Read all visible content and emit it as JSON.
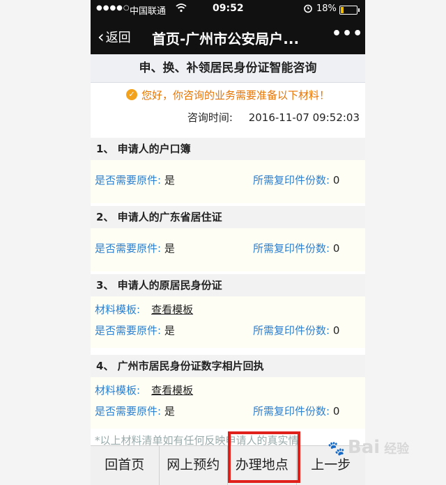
{
  "status_bar": {
    "signal": "●●●●○",
    "carrier": "中国联通",
    "time": "09:52",
    "battery_text": "18%",
    "battery_level": 0.18
  },
  "nav": {
    "back_label": "返回",
    "title": "首页-广州市公安局户...",
    "more": "•••"
  },
  "page_header": "申、换、补领居民身份证智能咨询",
  "notice": "您好，你咨询的业务需要准备以下材料！",
  "query_time": {
    "label": "咨询时间:",
    "value": "2016-11-07 09:52:03"
  },
  "sections": [
    {
      "title": "1、 申请人的户口簿",
      "original_label": "是否需要原件:",
      "original_value": "是",
      "copies_label": "所需复印件份数:",
      "copies_value": "0"
    },
    {
      "title": "2、 申请人的广东省居住证",
      "original_label": "是否需要原件:",
      "original_value": "是",
      "copies_label": "所需复印件份数:",
      "copies_value": "0"
    },
    {
      "title": "3、 申请人的原居民身份证",
      "template_label": "材料模板:",
      "template_link": "查看模板",
      "original_label": "是否需要原件:",
      "original_value": "是",
      "copies_label": "所需复印件份数:",
      "copies_value": "0"
    },
    {
      "title": "4、 广州市居民身份证数字相片回执",
      "template_label": "材料模板:",
      "template_link": "查看模板",
      "original_label": "是否需要原件:",
      "original_value": "是",
      "copies_label": "所需复印件份数:",
      "copies_value": "0"
    }
  ],
  "faded_text": "*以上材料清单如有任何反映申请人的真实情",
  "bottom_buttons": [
    "回首页",
    "网上预约",
    "办理地点",
    "上一步"
  ],
  "watermark": {
    "brand": "Bai",
    "suffix": "经验"
  },
  "colors": {
    "link_blue": "#2a7fd0",
    "notice_orange": "#e87400",
    "highlight_red": "#e0201a"
  }
}
